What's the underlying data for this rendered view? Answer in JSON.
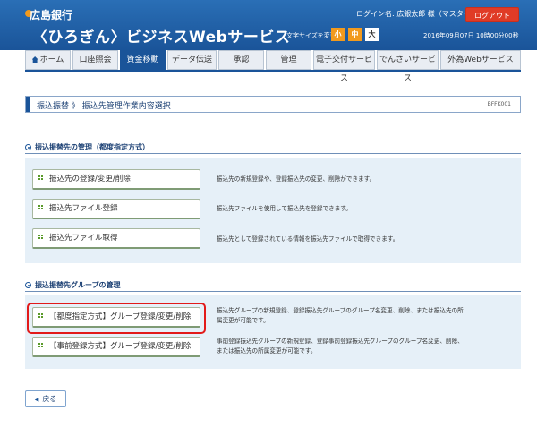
{
  "header": {
    "bank_name": "広島銀行",
    "service_name": "〈ひろぎん〉ビジネスWebサービス",
    "login_name": "ログイン名: 広銀太郎 様（マスターユーザ）",
    "logout_label": "ログアウト",
    "font_size_label": "文字サイズを変更",
    "font_small": "小",
    "font_medium": "中",
    "font_large": "大",
    "datetime": "2016年09月07日 10時00分00秒"
  },
  "nav": {
    "tabs": [
      {
        "label": "ホーム"
      },
      {
        "label": "口座照会"
      },
      {
        "label": "資金移動"
      },
      {
        "label": "データ伝送"
      },
      {
        "label": "承認"
      },
      {
        "label": "管理"
      },
      {
        "label": "電子交付サービス"
      },
      {
        "label": "でんさいサービス"
      },
      {
        "label": "外為Webサービス"
      }
    ],
    "active": "資金移動"
  },
  "page": {
    "title": "振込振替 》 振込先管理作業内容選択",
    "screen_code": "BFFK001"
  },
  "section1": {
    "heading": "振込振替先の管理（都度指定方式）",
    "items": [
      {
        "label": "振込先の登録/変更/削除",
        "desc": "振込先の新規登録や、登録振込先の変更、削除ができます。"
      },
      {
        "label": "振込先ファイル登録",
        "desc": "振込先ファイルを使用して振込先を登録できます。"
      },
      {
        "label": "振込先ファイル取得",
        "desc": "振込先として登録されている情報を振込先ファイルで取得できます。"
      }
    ]
  },
  "section2": {
    "heading": "振込振替先グループの管理",
    "items": [
      {
        "label": "【都度指定方式】グループ登録/変更/削除",
        "desc_line1": "振込先グループの新規登録、登録振込先グループのグループ名変更、削除、または振込先の所",
        "desc_line2": "属変更が可能です。"
      },
      {
        "label": "【事前登録方式】グループ登録/変更/削除",
        "desc_line1": "事前登録振込先グループの新規登録、登録事前登録振込先グループのグループ名変更、削除、",
        "desc_line2": "または振込先の所属変更が可能です。"
      }
    ]
  },
  "footer": {
    "back_label": "戻る"
  },
  "colors": {
    "header_blue": "#1a5499",
    "logout_red": "#e03b26",
    "highlight_red": "#e21a1a",
    "panel_bg": "#e6f0f8",
    "button_green_dot": "#5a9a2a"
  }
}
